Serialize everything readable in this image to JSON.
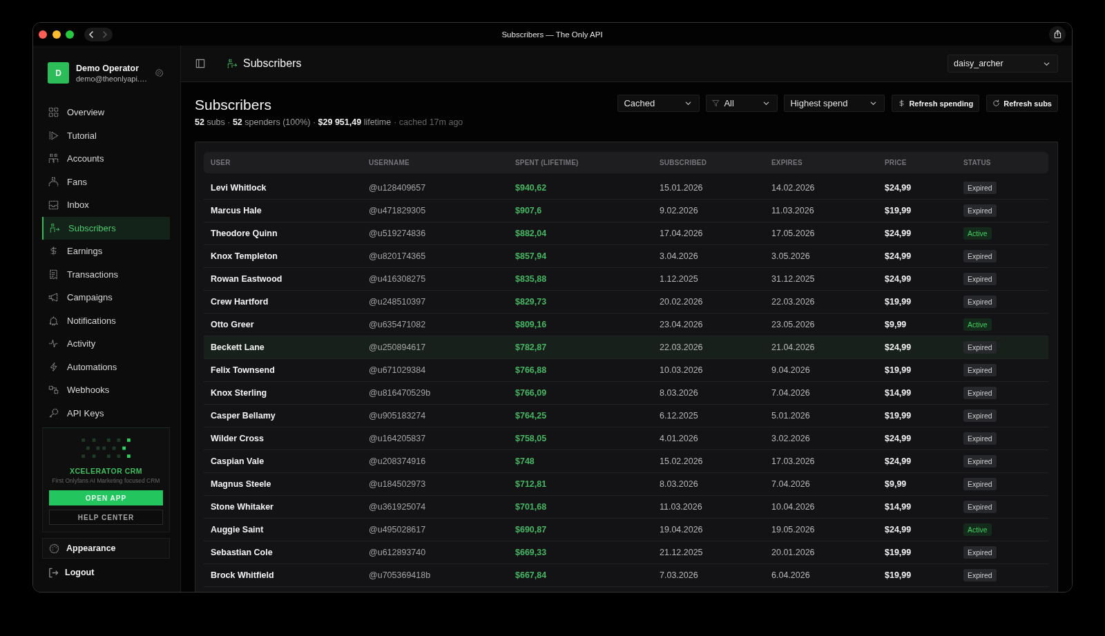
{
  "window": {
    "title": "Subscribers — The Only API",
    "back": {
      "disabled": false
    },
    "forward": {
      "disabled": true
    }
  },
  "sidebar": {
    "profile": {
      "initial": "D",
      "name": "Demo Operator",
      "email": "demo@theonlyapi.…"
    },
    "nav_items": [
      {
        "label": "Overview",
        "selected": false
      },
      {
        "label": "Tutorial",
        "selected": false
      },
      {
        "label": "Accounts",
        "selected": false
      },
      {
        "label": "Fans",
        "selected": false
      },
      {
        "label": "Inbox",
        "selected": false
      },
      {
        "label": "Subscribers",
        "selected": true
      },
      {
        "label": "Earnings",
        "selected": false
      },
      {
        "label": "Transactions",
        "selected": false
      },
      {
        "label": "Campaigns",
        "selected": false
      },
      {
        "label": "Notifications",
        "selected": false
      },
      {
        "label": "Activity",
        "selected": false
      },
      {
        "label": "Automations",
        "selected": false
      },
      {
        "label": "Webhooks",
        "selected": false
      },
      {
        "label": "API Keys",
        "selected": false
      }
    ],
    "promo": {
      "title": "XCELERATOR CRM",
      "subtitle": "First Onlyfans AI Marketing focused CRM",
      "primary_button": "OPEN APP",
      "secondary_button": "HELP CENTER"
    },
    "appearance": "Appearance",
    "logout": "Logout"
  },
  "header": {
    "title": "Subscribers",
    "account_select": {
      "value": "daisy_archer"
    }
  },
  "content": {
    "title": "Subscribers",
    "summary": "**52** subs · **52** spenders (100%) · **$29 951,49** lifetime",
    "cache_status": "· cached 17m ago",
    "source_select": {
      "value": "Cached"
    },
    "status_filter": {
      "value": "All"
    },
    "sort_select": {
      "value": "Highest spend"
    },
    "buttons": [
      {
        "label": "Refresh spending"
      },
      {
        "label": "Refresh subs"
      }
    ]
  },
  "table": {
    "columns": [
      "USER",
      "USERNAME",
      "SPENT (LIFETIME)",
      "SUBSCRIBED",
      "EXPIRES",
      "PRICE",
      "STATUS"
    ],
    "rows": [
      {
        "user": "Levi Whitlock",
        "username": "@u128409657",
        "spent": "$940,62",
        "subscribed": "15.01.2026",
        "expires": "14.02.2026",
        "price": "$24,99",
        "status": {
          "label": "Expired",
          "kind": "expired"
        },
        "highlighted": false
      },
      {
        "user": "Marcus Hale",
        "username": "@u471829305",
        "spent": "$907,6",
        "subscribed": "9.02.2026",
        "expires": "11.03.2026",
        "price": "$19,99",
        "status": {
          "label": "Expired",
          "kind": "expired"
        },
        "highlighted": false
      },
      {
        "user": "Theodore Quinn",
        "username": "@u519274836",
        "spent": "$882,04",
        "subscribed": "17.04.2026",
        "expires": "17.05.2026",
        "price": "$24,99",
        "status": {
          "label": "Active",
          "kind": "active"
        },
        "highlighted": false
      },
      {
        "user": "Knox Templeton",
        "username": "@u820174365",
        "spent": "$857,94",
        "subscribed": "3.04.2026",
        "expires": "3.05.2026",
        "price": "$24,99",
        "status": {
          "label": "Expired",
          "kind": "expired"
        },
        "highlighted": false
      },
      {
        "user": "Rowan Eastwood",
        "username": "@u416308275",
        "spent": "$835,88",
        "subscribed": "1.12.2025",
        "expires": "31.12.2025",
        "price": "$24,99",
        "status": {
          "label": "Expired",
          "kind": "expired"
        },
        "highlighted": false
      },
      {
        "user": "Crew Hartford",
        "username": "@u248510397",
        "spent": "$829,73",
        "subscribed": "20.02.2026",
        "expires": "22.03.2026",
        "price": "$19,99",
        "status": {
          "label": "Expired",
          "kind": "expired"
        },
        "highlighted": false
      },
      {
        "user": "Otto Greer",
        "username": "@u635471082",
        "spent": "$809,16",
        "subscribed": "23.04.2026",
        "expires": "23.05.2026",
        "price": "$9,99",
        "status": {
          "label": "Active",
          "kind": "active"
        },
        "highlighted": false
      },
      {
        "user": "Beckett Lane",
        "username": "@u250894617",
        "spent": "$782,87",
        "subscribed": "22.03.2026",
        "expires": "21.04.2026",
        "price": "$24,99",
        "status": {
          "label": "Expired",
          "kind": "expired"
        },
        "highlighted": true
      },
      {
        "user": "Felix Townsend",
        "username": "@u671029384",
        "spent": "$766,88",
        "subscribed": "10.03.2026",
        "expires": "9.04.2026",
        "price": "$19,99",
        "status": {
          "label": "Expired",
          "kind": "expired"
        },
        "highlighted": false
      },
      {
        "user": "Knox Sterling",
        "username": "@u816470529b",
        "spent": "$766,09",
        "subscribed": "8.03.2026",
        "expires": "7.04.2026",
        "price": "$14,99",
        "status": {
          "label": "Expired",
          "kind": "expired"
        },
        "highlighted": false
      },
      {
        "user": "Casper Bellamy",
        "username": "@u905183274",
        "spent": "$764,25",
        "subscribed": "6.12.2025",
        "expires": "5.01.2026",
        "price": "$19,99",
        "status": {
          "label": "Expired",
          "kind": "expired"
        },
        "highlighted": false
      },
      {
        "user": "Wilder Cross",
        "username": "@u164205837",
        "spent": "$758,05",
        "subscribed": "4.01.2026",
        "expires": "3.02.2026",
        "price": "$24,99",
        "status": {
          "label": "Expired",
          "kind": "expired"
        },
        "highlighted": false
      },
      {
        "user": "Caspian Vale",
        "username": "@u208374916",
        "spent": "$748",
        "subscribed": "15.02.2026",
        "expires": "17.03.2026",
        "price": "$24,99",
        "status": {
          "label": "Expired",
          "kind": "expired"
        },
        "highlighted": false
      },
      {
        "user": "Magnus Steele",
        "username": "@u184502973",
        "spent": "$712,81",
        "subscribed": "8.03.2026",
        "expires": "7.04.2026",
        "price": "$9,99",
        "status": {
          "label": "Expired",
          "kind": "expired"
        },
        "highlighted": false
      },
      {
        "user": "Stone Whitaker",
        "username": "@u361925074",
        "spent": "$701,68",
        "subscribed": "11.03.2026",
        "expires": "10.04.2026",
        "price": "$14,99",
        "status": {
          "label": "Expired",
          "kind": "expired"
        },
        "highlighted": false
      },
      {
        "user": "Auggie Saint",
        "username": "@u495028617",
        "spent": "$690,87",
        "subscribed": "19.04.2026",
        "expires": "19.05.2026",
        "price": "$24,99",
        "status": {
          "label": "Active",
          "kind": "active"
        },
        "highlighted": false
      },
      {
        "user": "Sebastian Cole",
        "username": "@u612893740",
        "spent": "$669,33",
        "subscribed": "21.12.2025",
        "expires": "20.01.2026",
        "price": "$19,99",
        "status": {
          "label": "Expired",
          "kind": "expired"
        },
        "highlighted": false
      },
      {
        "user": "Brock Whitfield",
        "username": "@u705369418b",
        "spent": "$667,84",
        "subscribed": "7.03.2026",
        "expires": "6.04.2026",
        "price": "$19,99",
        "status": {
          "label": "Expired",
          "kind": "expired"
        },
        "highlighted": false
      }
    ]
  }
}
